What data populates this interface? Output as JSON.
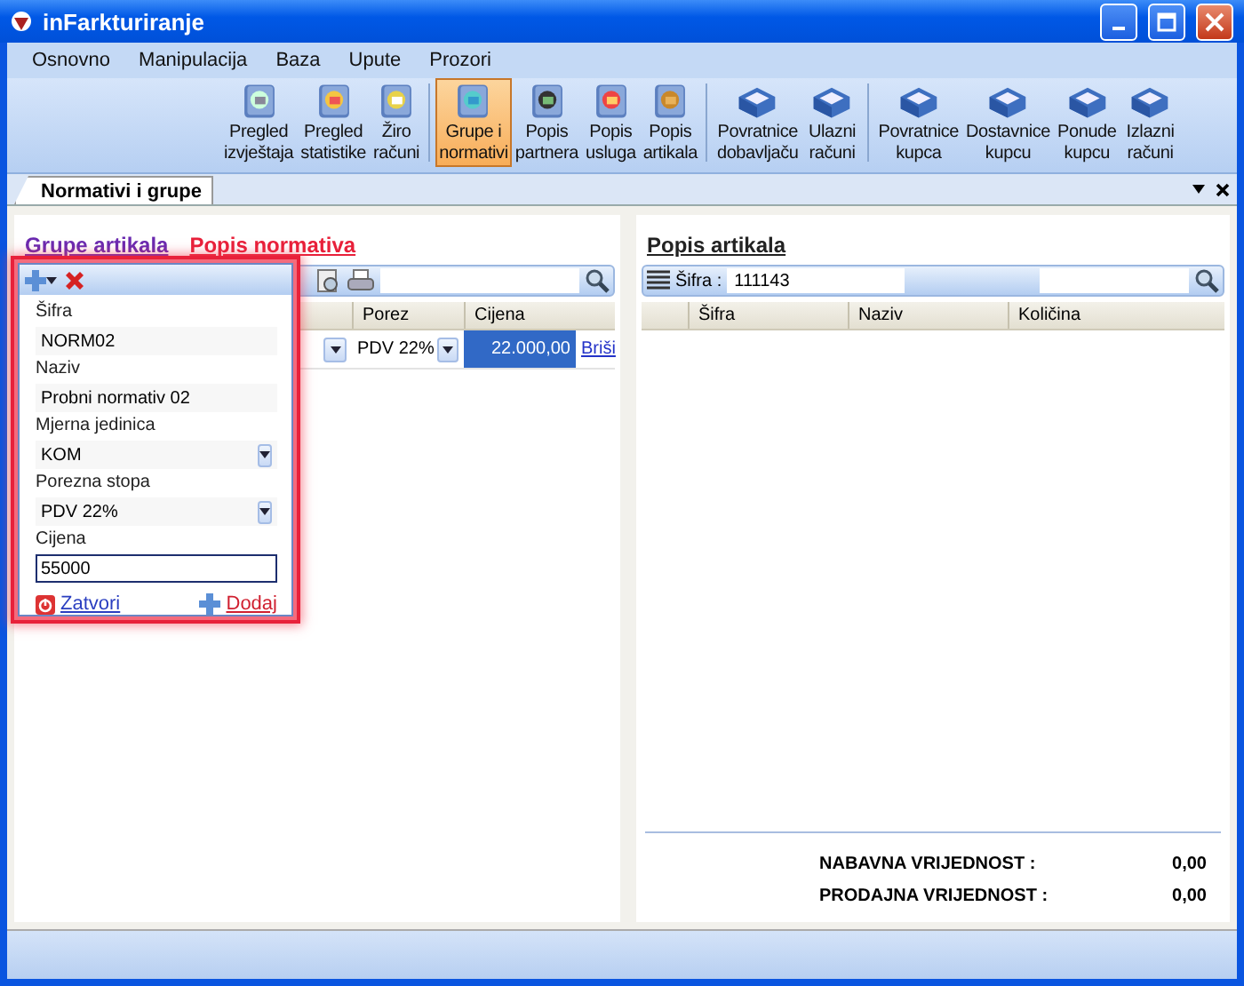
{
  "window": {
    "title": "inFarkturiranje"
  },
  "menu": [
    "Osnovno",
    "Manipulacija",
    "Baza",
    "Upute",
    "Prozori"
  ],
  "toolbar": [
    [
      {
        "lines": [
          "Pregled",
          "izvještaja"
        ],
        "selected": false
      },
      {
        "lines": [
          "Pregled",
          "statistike"
        ],
        "selected": false
      },
      {
        "lines": [
          "Žiro",
          "računi"
        ],
        "selected": false
      }
    ],
    [
      {
        "lines": [
          "Grupe i",
          "normativi"
        ],
        "selected": true
      },
      {
        "lines": [
          "Popis",
          "partnera"
        ],
        "selected": false
      },
      {
        "lines": [
          "Popis",
          "usluga"
        ],
        "selected": false
      },
      {
        "lines": [
          "Popis",
          "artikala"
        ],
        "selected": false
      }
    ],
    [
      {
        "lines": [
          "Povratnice",
          "dobavljaču"
        ],
        "selected": false
      },
      {
        "lines": [
          "Ulazni",
          "računi"
        ],
        "selected": false
      }
    ],
    [
      {
        "lines": [
          "Povratnice",
          "kupca"
        ],
        "selected": false
      },
      {
        "lines": [
          "Dostavnice",
          "kupcu"
        ],
        "selected": false
      },
      {
        "lines": [
          "Ponude",
          "kupcu"
        ],
        "selected": false
      },
      {
        "lines": [
          "Izlazni",
          "računi"
        ],
        "selected": false
      }
    ]
  ],
  "tabs": [
    {
      "label": "Normativi i grupe",
      "selected": true
    }
  ],
  "left": {
    "links": [
      {
        "label": "Grupe artikala",
        "selected": false
      },
      {
        "label": "Popis normativa",
        "selected": true
      }
    ],
    "columns": [
      "Porez",
      "Cijena"
    ],
    "rows": [
      {
        "porez": "PDV 22%",
        "cijena": "22.000,00",
        "action": "Briši",
        "selected": true
      }
    ]
  },
  "popup": {
    "fields": [
      {
        "label": "Šifra",
        "value": "NORM02",
        "kind": "text"
      },
      {
        "label": "Naziv",
        "value": "Probni normativ 02",
        "kind": "text"
      },
      {
        "label": "Mjerna jedinica",
        "value": "KOM",
        "kind": "select"
      },
      {
        "label": "Porezna stopa",
        "value": "PDV 22%",
        "kind": "select"
      },
      {
        "label": "Cijena",
        "value": "55000",
        "kind": "focused"
      }
    ],
    "close": "Zatvori",
    "add": "Dodaj"
  },
  "right": {
    "title": "Popis artikala",
    "search_label": "Šifra :",
    "search_value": "111143",
    "columns": [
      "Šifra",
      "Naziv",
      "Količina"
    ],
    "totals": [
      {
        "label": "NABAVNA VRIJEDNOST :",
        "value": "0,00"
      },
      {
        "label": "PRODAJNA VRIJEDNOST :",
        "value": "0,00"
      }
    ]
  }
}
